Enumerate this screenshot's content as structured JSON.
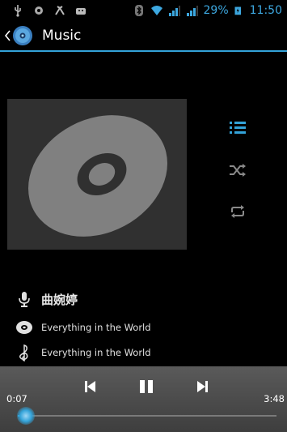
{
  "status_bar": {
    "battery_percent": "29%",
    "time": "11:50",
    "accent_color": "#3da8e0",
    "icons": [
      "usb-icon",
      "notification-icon",
      "debug-icon",
      "android-icon",
      "bluetooth-icon",
      "wifi-icon",
      "signal-icon",
      "signal-icon",
      "battery-icon"
    ]
  },
  "action_bar": {
    "title": "Music",
    "icons": [
      "back-icon",
      "music-app-icon"
    ]
  },
  "accent_color": "#33a3d9",
  "side_controls": [
    "queue-list-icon",
    "shuffle-icon",
    "repeat-icon"
  ],
  "track": {
    "artist": "曲婉婷",
    "album": "Everything in the World",
    "title": "Everything in the World"
  },
  "playback": {
    "current_time": "0:07",
    "total_time": "3:48",
    "progress": 0.031,
    "controls": [
      "previous-icon",
      "pause-icon",
      "next-icon"
    ]
  }
}
